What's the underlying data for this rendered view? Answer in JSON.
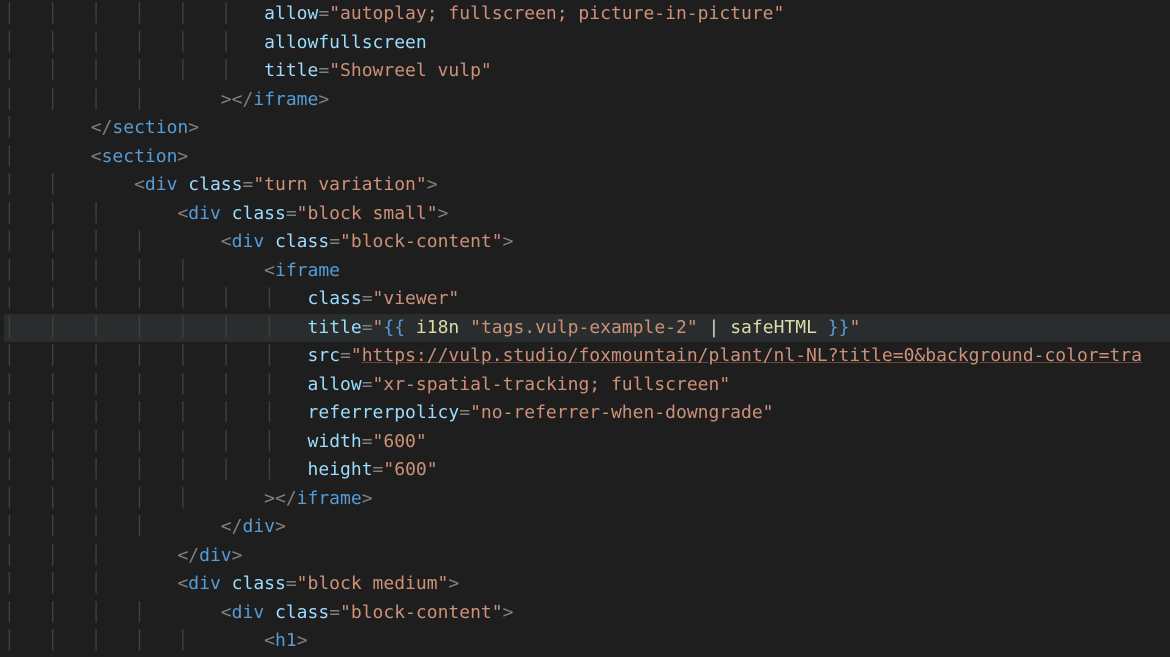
{
  "indentWidth": 4,
  "guideChar": "│",
  "highlightedLineIndex": 11,
  "lines": [
    {
      "indent": 6,
      "cursorAfterGuides": true,
      "tokens": [
        {
          "t": "attr",
          "v": "allow"
        },
        {
          "t": "br",
          "v": "="
        },
        {
          "t": "str",
          "v": "\"autoplay; fullscreen; picture-in-picture\""
        }
      ]
    },
    {
      "indent": 6,
      "cursorAfterGuides": true,
      "tokens": [
        {
          "t": "attr",
          "v": "allowfullscreen"
        }
      ]
    },
    {
      "indent": 6,
      "cursorAfterGuides": true,
      "tokens": [
        {
          "t": "attr",
          "v": "title"
        },
        {
          "t": "br",
          "v": "="
        },
        {
          "t": "str",
          "v": "\"Showreel vulp\""
        }
      ]
    },
    {
      "indent": 5,
      "cursorAfterGuides": false,
      "tokens": [
        {
          "t": "br",
          "v": "></"
        },
        {
          "t": "tag",
          "v": "iframe"
        },
        {
          "t": "br",
          "v": ">"
        }
      ]
    },
    {
      "indent": 2,
      "cursorAfterGuides": false,
      "tokens": [
        {
          "t": "br",
          "v": "</"
        },
        {
          "t": "tag",
          "v": "section"
        },
        {
          "t": "br",
          "v": ">"
        }
      ]
    },
    {
      "indent": 2,
      "cursorAfterGuides": false,
      "tokens": [
        {
          "t": "br",
          "v": "<"
        },
        {
          "t": "tag",
          "v": "section"
        },
        {
          "t": "br",
          "v": ">"
        }
      ]
    },
    {
      "indent": 3,
      "cursorAfterGuides": false,
      "tokens": [
        {
          "t": "br",
          "v": "<"
        },
        {
          "t": "tag",
          "v": "div"
        },
        {
          "t": "sp",
          "v": " "
        },
        {
          "t": "attr",
          "v": "class"
        },
        {
          "t": "br",
          "v": "="
        },
        {
          "t": "str",
          "v": "\"turn variation\""
        },
        {
          "t": "br",
          "v": ">"
        }
      ]
    },
    {
      "indent": 4,
      "cursorAfterGuides": false,
      "tokens": [
        {
          "t": "br",
          "v": "<"
        },
        {
          "t": "tag",
          "v": "div"
        },
        {
          "t": "sp",
          "v": " "
        },
        {
          "t": "attr",
          "v": "class"
        },
        {
          "t": "br",
          "v": "="
        },
        {
          "t": "str",
          "v": "\"block small\""
        },
        {
          "t": "br",
          "v": ">"
        }
      ]
    },
    {
      "indent": 5,
      "cursorAfterGuides": false,
      "tokens": [
        {
          "t": "br",
          "v": "<"
        },
        {
          "t": "tag",
          "v": "div"
        },
        {
          "t": "sp",
          "v": " "
        },
        {
          "t": "attr",
          "v": "class"
        },
        {
          "t": "br",
          "v": "="
        },
        {
          "t": "str",
          "v": "\"block-content\""
        },
        {
          "t": "br",
          "v": ">"
        }
      ]
    },
    {
      "indent": 6,
      "cursorAfterGuides": false,
      "tokens": [
        {
          "t": "br",
          "v": "<"
        },
        {
          "t": "tag",
          "v": "iframe"
        }
      ]
    },
    {
      "indent": 7,
      "cursorAfterGuides": true,
      "tokens": [
        {
          "t": "attr",
          "v": "class"
        },
        {
          "t": "br",
          "v": "="
        },
        {
          "t": "str",
          "v": "\"viewer\""
        }
      ]
    },
    {
      "indent": 7,
      "cursorAfterGuides": true,
      "tokens": [
        {
          "t": "attr",
          "v": "title"
        },
        {
          "t": "br",
          "v": "="
        },
        {
          "t": "str",
          "v": "\""
        },
        {
          "t": "tmpl-delim",
          "v": "{{ "
        },
        {
          "t": "tmpl-id",
          "v": "i18n"
        },
        {
          "t": "sp",
          "v": " "
        },
        {
          "t": "tmpl-str",
          "v": "\"tags.vulp-example-2\""
        },
        {
          "t": "sp",
          "v": " "
        },
        {
          "t": "tmpl-op",
          "v": "|"
        },
        {
          "t": "sp",
          "v": " "
        },
        {
          "t": "tmpl-id",
          "v": "safeHTML"
        },
        {
          "t": "tmpl-delim",
          "v": " }}"
        },
        {
          "t": "str",
          "v": "\""
        }
      ]
    },
    {
      "indent": 7,
      "cursorAfterGuides": true,
      "tokens": [
        {
          "t": "attr",
          "v": "src"
        },
        {
          "t": "br",
          "v": "="
        },
        {
          "t": "str",
          "v": "\""
        },
        {
          "t": "url",
          "v": "https://vulp.studio/foxmountain/plant/nl-NL?title=0&background-color=tra"
        }
      ]
    },
    {
      "indent": 7,
      "cursorAfterGuides": true,
      "tokens": [
        {
          "t": "attr",
          "v": "allow"
        },
        {
          "t": "br",
          "v": "="
        },
        {
          "t": "str",
          "v": "\"xr-spatial-tracking; fullscreen\""
        }
      ]
    },
    {
      "indent": 7,
      "cursorAfterGuides": true,
      "tokens": [
        {
          "t": "attr",
          "v": "referrerpolicy"
        },
        {
          "t": "br",
          "v": "="
        },
        {
          "t": "str",
          "v": "\"no-referrer-when-downgrade\""
        }
      ]
    },
    {
      "indent": 7,
      "cursorAfterGuides": true,
      "tokens": [
        {
          "t": "attr",
          "v": "width"
        },
        {
          "t": "br",
          "v": "="
        },
        {
          "t": "str",
          "v": "\"600\""
        }
      ]
    },
    {
      "indent": 7,
      "cursorAfterGuides": true,
      "tokens": [
        {
          "t": "attr",
          "v": "height"
        },
        {
          "t": "br",
          "v": "="
        },
        {
          "t": "str",
          "v": "\"600\""
        }
      ]
    },
    {
      "indent": 6,
      "cursorAfterGuides": false,
      "tokens": [
        {
          "t": "br",
          "v": "></"
        },
        {
          "t": "tag",
          "v": "iframe"
        },
        {
          "t": "br",
          "v": ">"
        }
      ]
    },
    {
      "indent": 5,
      "cursorAfterGuides": false,
      "tokens": [
        {
          "t": "br",
          "v": "</"
        },
        {
          "t": "tag",
          "v": "div"
        },
        {
          "t": "br",
          "v": ">"
        }
      ]
    },
    {
      "indent": 4,
      "cursorAfterGuides": false,
      "tokens": [
        {
          "t": "br",
          "v": "</"
        },
        {
          "t": "tag",
          "v": "div"
        },
        {
          "t": "br",
          "v": ">"
        }
      ]
    },
    {
      "indent": 4,
      "cursorAfterGuides": false,
      "tokens": [
        {
          "t": "br",
          "v": "<"
        },
        {
          "t": "tag",
          "v": "div"
        },
        {
          "t": "sp",
          "v": " "
        },
        {
          "t": "attr",
          "v": "class"
        },
        {
          "t": "br",
          "v": "="
        },
        {
          "t": "str",
          "v": "\"block medium\""
        },
        {
          "t": "br",
          "v": ">"
        }
      ]
    },
    {
      "indent": 5,
      "cursorAfterGuides": false,
      "tokens": [
        {
          "t": "br",
          "v": "<"
        },
        {
          "t": "tag",
          "v": "div"
        },
        {
          "t": "sp",
          "v": " "
        },
        {
          "t": "attr",
          "v": "class"
        },
        {
          "t": "br",
          "v": "="
        },
        {
          "t": "str",
          "v": "\"block-content\""
        },
        {
          "t": "br",
          "v": ">"
        }
      ]
    },
    {
      "indent": 6,
      "cursorAfterGuides": false,
      "tokens": [
        {
          "t": "br",
          "v": "<"
        },
        {
          "t": "tag",
          "v": "h1"
        },
        {
          "t": "br",
          "v": ">"
        }
      ]
    }
  ]
}
